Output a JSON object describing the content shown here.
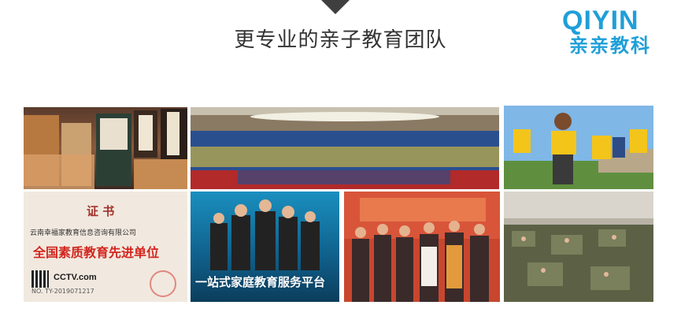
{
  "header": {
    "title": "更专业的亲子教育团队"
  },
  "logo": {
    "latin": "QIYIN",
    "chinese": "亲亲教科",
    "color": "#1f9fd8"
  },
  "photos": {
    "certificate": {
      "heading": "证 书",
      "org": "云南幸福家教育信息咨询有限公司",
      "award": "全国素质教育先进单位",
      "issuer": "CCTV.com",
      "number": "NO. TY-2019071217"
    },
    "platform": {
      "slogan": "一站式家庭教育服务平台"
    }
  }
}
